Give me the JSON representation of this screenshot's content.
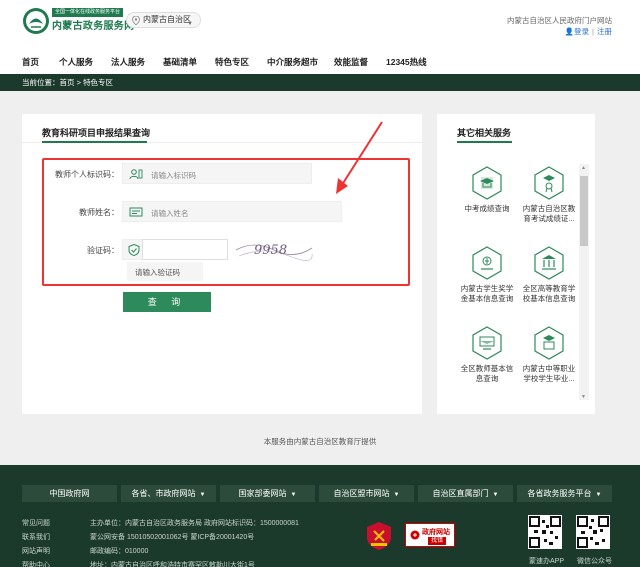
{
  "header": {
    "logo_tagline": "全国一体化在线政务服务平台",
    "logo_title": "内蒙古政务服务网",
    "region": "内蒙古自治区",
    "portal_link": "内蒙古自治区人民政府门户网站",
    "login": "登录",
    "register": "注册",
    "colors": {
      "brand": "#1f7a4f",
      "dark": "#1c3a2b",
      "accent_red": "#e33333"
    }
  },
  "nav": {
    "items": [
      "首页",
      "个人服务",
      "法人服务",
      "基础清单",
      "特色专区",
      "中介服务超市",
      "效能监督",
      "12345热线"
    ]
  },
  "breadcrumb": {
    "prefix": "当前位置：",
    "home": "首页",
    "sep": " > ",
    "current": "特色专区"
  },
  "form": {
    "title": "教育科研项目申报结果查询",
    "id_label": "教师个人标识码：",
    "id_placeholder": "请输入标识码",
    "name_label": "教师姓名：",
    "name_placeholder": "请输入姓名",
    "captcha_label": "验证码：",
    "captcha_placeholder": "请输入验证码",
    "captcha_text": "9958",
    "submit": "查 询"
  },
  "side": {
    "title": "其它相关服务",
    "services": [
      {
        "label1": "中考成绩查询",
        "label2": "",
        "icon": "graduation-cap-icon"
      },
      {
        "label1": "内蒙古自治区教",
        "label2": "育考试成绩证...",
        "icon": "certificate-icon"
      },
      {
        "label1": "内蒙古学生奖学",
        "label2": "金基本信息查询",
        "icon": "scholarship-icon"
      },
      {
        "label1": "全区高等教育学",
        "label2": "校基本信息查询",
        "icon": "university-icon"
      },
      {
        "label1": "全区教师基本信",
        "label2": "息查询",
        "icon": "teacher-icon"
      },
      {
        "label1": "内蒙古中等职业",
        "label2": "学校学生毕业...",
        "icon": "diploma-icon"
      }
    ]
  },
  "provider": "本服务由内蒙古自治区教育厅提供",
  "footer": {
    "links": [
      "中国政府网",
      "各省、市政府网站",
      "国家部委网站",
      "自治区盟市网站",
      "自治区直属部门",
      "各省政务服务平台"
    ],
    "left_links": [
      "常见问题",
      "联系我们",
      "网站声明",
      "帮助中心"
    ],
    "info_lines": [
      "主办单位：内蒙古自治区政务服务局    政府网站标识码：1500000081",
      "蒙公网安备 15010502001062号    蒙ICP备20001420号",
      "邮政编码：010000",
      "地址：内蒙古自治区呼和浩特市赛罕区敕勒川大街1号"
    ],
    "badge_text1": "政府网站",
    "badge_text2": "找错",
    "qr_labels": [
      "蒙速办APP",
      "微信公众号"
    ]
  }
}
